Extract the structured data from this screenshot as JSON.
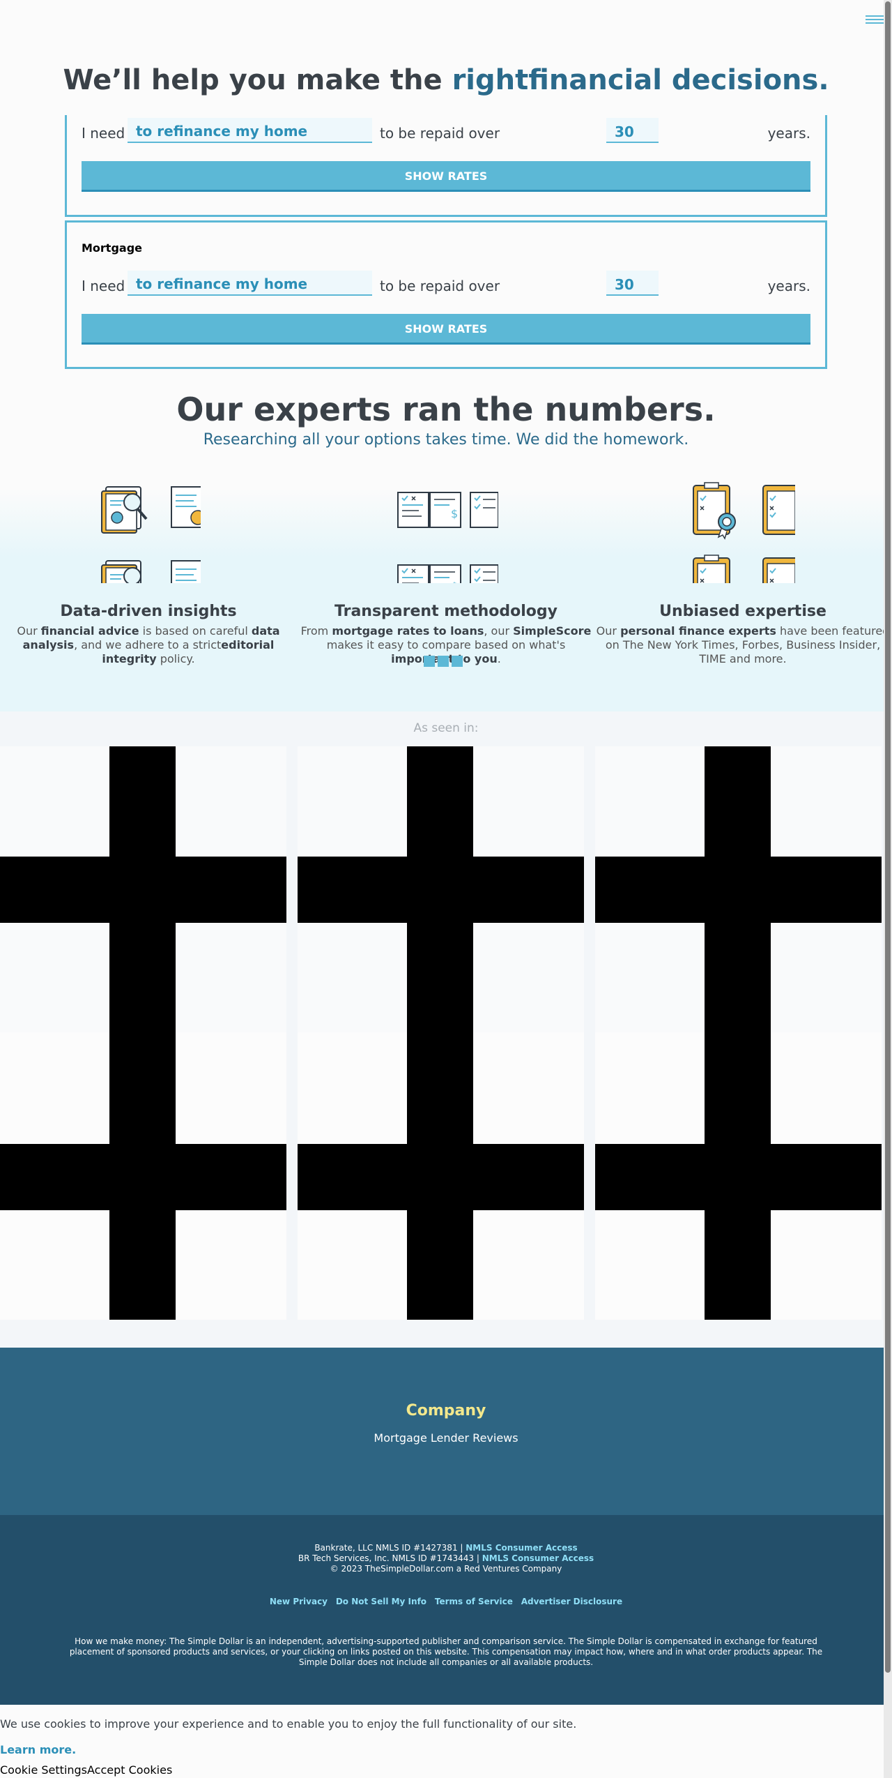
{
  "hero": {
    "title_lead": "We’ll help you make the ",
    "title_accent": "rightfinancial decisions."
  },
  "calculators": [
    {
      "label": "",
      "prefix": "I need",
      "purpose": "to refinance my home",
      "middle": "to be repaid over",
      "years_value": "30",
      "suffix": "years.",
      "button": "SHOW RATES"
    },
    {
      "label": "Mortgage",
      "prefix": "I need",
      "purpose": "to refinance my home",
      "middle": "to be repaid over",
      "years_value": "30",
      "suffix": "years.",
      "button": "SHOW RATES"
    }
  ],
  "experts": {
    "title": "Our experts ran the numbers.",
    "subtitle": "Researching all your options takes time. We did the homework.",
    "features": [
      {
        "icon": "magnifier-chart-icon",
        "title": "Data-driven insights"
      },
      {
        "icon": "calculator-form-icon",
        "title": "Transparent methodology"
      },
      {
        "icon": "clipboard-award-icon",
        "title": "Unbiased expertise"
      }
    ],
    "f1": {
      "a": "Our ",
      "b": "financial advice",
      "c": " is based on careful ",
      "d": "data analysis",
      "e": ", and we adhere to a strict",
      "f": "editorial integrity",
      "g": " policy."
    },
    "f2": {
      "a": "From ",
      "b": "mortgage rates to loans",
      "c": ", our ",
      "d": "SimpleScore",
      "e": " makes it easy to compare based on what's ",
      "f": "important to you",
      "g": "."
    },
    "f3": {
      "a": "Our ",
      "b": "personal finance experts",
      "c": " have been featured on The New York Times, Forbes, Business Insider, TIME and more."
    }
  },
  "seen_in": {
    "label": "As seen in:"
  },
  "footer": {
    "heading": "Company",
    "link": "Mortgage Lender Reviews",
    "lic1": "Bankrate, LLC NMLS ID #1427381 | ",
    "lic2": "BR Tech Services, Inc. NMLS ID #1743443 | ",
    "nmls": "NMLS Consumer Access",
    "copyright": "© 2023 TheSimpleDollar.com a Red Ventures Company",
    "links": [
      "New Privacy",
      "Do Not Sell My Info",
      "Terms of Service",
      "Advertiser Disclosure"
    ],
    "money": "How we make money: The Simple Dollar is an independent, advertising-supported publisher and comparison service. The Simple Dollar is compensated in exchange for featured placement of sponsored products and services, or your clicking on links posted on this website. This compensation may impact how, where and in what order products appear. The Simple Dollar does not include all companies or all available products."
  },
  "cookie": {
    "message": "We use cookies to improve your experience and to enable you to enjoy the full functionality of our site.",
    "learn_more": "Learn more.",
    "settings": "Cookie Settings",
    "accept": "Accept Cookies"
  },
  "colors": {
    "accent": "#5cb8d6",
    "brand_dark": "#2b6a8b",
    "footer": "#2e6583",
    "footer_dark": "#234f6a",
    "gold": "#f3e88c"
  }
}
